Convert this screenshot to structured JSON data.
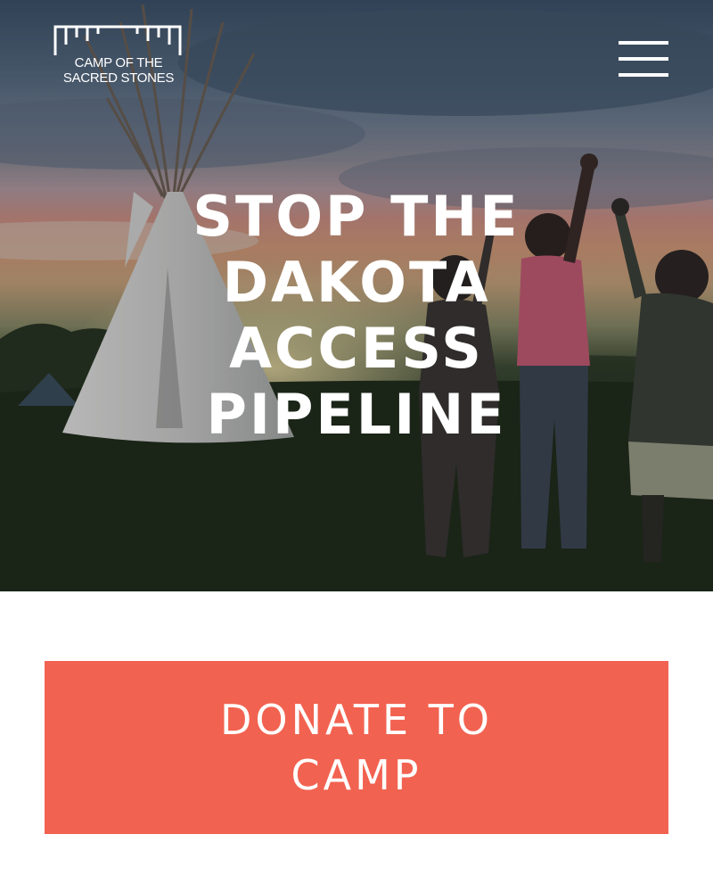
{
  "header": {
    "logo": {
      "line1": "CAMP OF THE",
      "line2": "SACRED STONES"
    },
    "menu_icon": "hamburger-menu-icon"
  },
  "hero": {
    "headline_lines": [
      "STOP THE",
      "DAKOTA",
      "ACCESS",
      "PIPELINE"
    ]
  },
  "donate": {
    "line1": "DONATE TO",
    "line2": "CAMP"
  },
  "colors": {
    "accent": "#f26250",
    "text_on_image": "#ffffff",
    "page_background": "#ffffff"
  }
}
